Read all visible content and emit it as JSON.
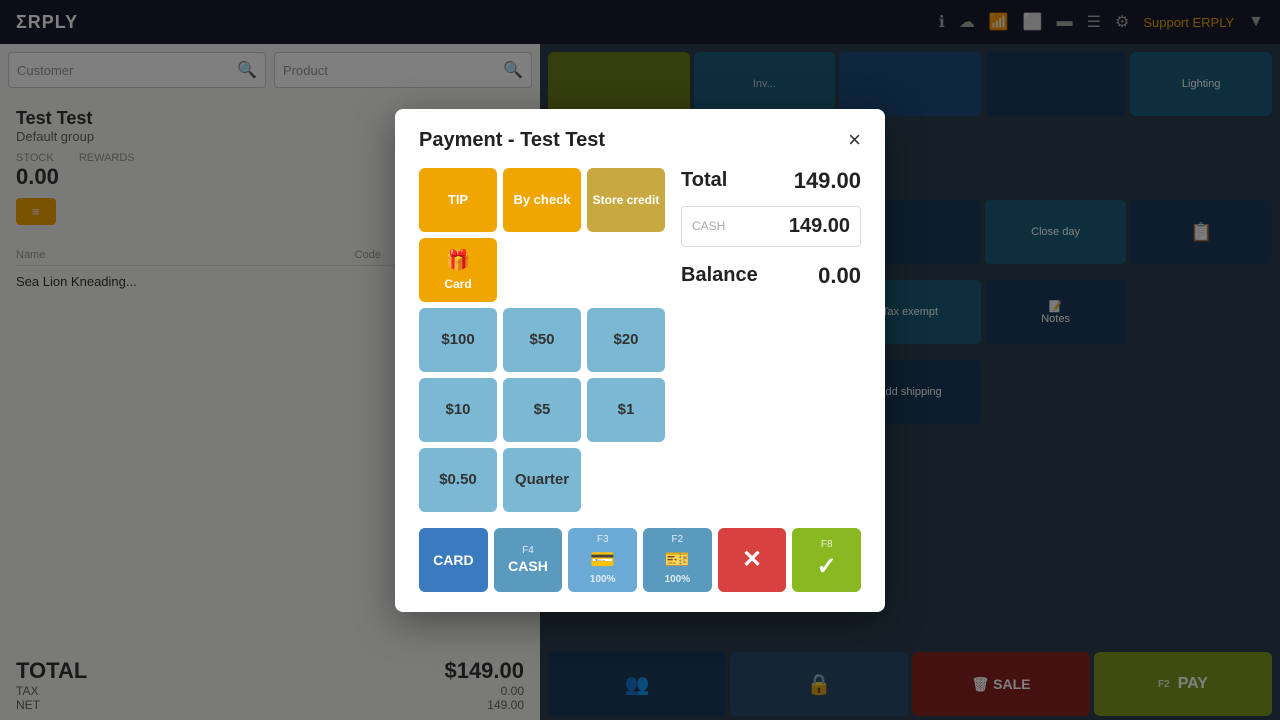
{
  "app": {
    "logo": "ΣRPLY",
    "support_label": "Support ERPLY",
    "nav_icons": [
      "ℹ",
      "☁",
      "📶",
      "⬜",
      "▬",
      "☰",
      "⚙"
    ]
  },
  "background": {
    "customer_placeholder": "Customer",
    "product_placeholder": "Product",
    "customer_name": "Test Test",
    "customer_group": "Default group",
    "stats": [
      {
        "label": "STOCK",
        "value": "0.00"
      },
      {
        "label": "REWARDS",
        "value": ""
      }
    ],
    "columns": [
      "Name",
      "Code"
    ],
    "items": [
      {
        "name": "Sea Lion Kneading...",
        "code": ""
      }
    ],
    "total_label": "TOTAL",
    "total_value": "$149.00",
    "tax_label": "TAX",
    "tax_value": "0.00",
    "net_label": "NET",
    "net_value": "149.00"
  },
  "modal": {
    "title": "Payment - Test Test",
    "close_label": "×",
    "total_label": "Total",
    "total_amount": "149.00",
    "cash_placeholder": "CASH",
    "cash_amount": "149.00",
    "balance_label": "Balance",
    "balance_amount": "0.00",
    "payment_methods": [
      {
        "id": "tip",
        "label": "TIP",
        "color": "yellow"
      },
      {
        "id": "by_check",
        "label": "By check",
        "color": "yellow"
      },
      {
        "id": "store_credit",
        "label": "Store credit",
        "color": "store_credit"
      },
      {
        "id": "gift_card",
        "label": "Card",
        "color": "gift",
        "icon": "🎁"
      }
    ],
    "denominations": [
      {
        "label": "$100"
      },
      {
        "label": "$50"
      },
      {
        "label": "$20"
      },
      {
        "label": "$10"
      },
      {
        "label": "$5"
      },
      {
        "label": "$1"
      },
      {
        "label": "$0.50"
      },
      {
        "label": "Quarter"
      }
    ],
    "action_buttons": [
      {
        "id": "card",
        "shortcut": "",
        "label": "CARD",
        "color": "card"
      },
      {
        "id": "cash",
        "shortcut": "F4",
        "label": "CASH",
        "color": "cash"
      },
      {
        "id": "credit",
        "shortcut": "F3",
        "label": "",
        "sublabel": "100%",
        "icon": "💳",
        "color": "creditcard"
      },
      {
        "id": "check",
        "shortcut": "F2",
        "label": "",
        "sublabel": "100%",
        "icon": "🎫",
        "color": "check"
      },
      {
        "id": "cancel",
        "shortcut": "",
        "label": "✕",
        "color": "cancel"
      },
      {
        "id": "confirm",
        "shortcut": "F8",
        "label": "✓",
        "color": "confirm"
      }
    ]
  }
}
